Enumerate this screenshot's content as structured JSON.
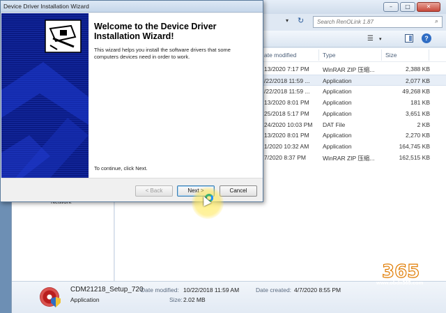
{
  "explorer": {
    "window_controls": {
      "minimize": "–",
      "maximize": "□",
      "close": "✕"
    },
    "address_dropdown": "▾",
    "refresh_icon": "↻",
    "search_placeholder": "Search RenOLink 1.87",
    "search_icon": "⌕",
    "views_icon": "☰",
    "views_dropdown": "▾",
    "help_label": "?",
    "nav_network": "Network",
    "columns": {
      "date": "ate modified",
      "type": "Type",
      "size": "Size"
    },
    "files": [
      {
        "date": "13/2020 7:17 PM",
        "type": "WinRAR ZIP 压缩...",
        "size": "2,388 KB"
      },
      {
        "date": "/22/2018 11:59 ...",
        "type": "Application",
        "size": "2,077 KB"
      },
      {
        "date": "/22/2018 11:59 ...",
        "type": "Application",
        "size": "49,268 KB"
      },
      {
        "date": "13/2020 8:01 PM",
        "type": "Application",
        "size": "181 KB"
      },
      {
        "date": "25/2018 5:17 PM",
        "type": "Application",
        "size": "3,651 KB"
      },
      {
        "date": "24/2020 10:03 PM",
        "type": "DAT File",
        "size": "2 KB"
      },
      {
        "date": "13/2020 8:01 PM",
        "type": "Application",
        "size": "2,270 KB"
      },
      {
        "date": "1/2020 10:32 AM",
        "type": "Application",
        "size": "164,745 KB"
      },
      {
        "date": "7/2020 8:37 PM",
        "type": "WinRAR ZIP 压缩...",
        "size": "162,515 KB"
      }
    ],
    "selected_index": 1,
    "details": {
      "filename": "CDM21218_Setup_720",
      "modified_label": "Date modified:",
      "modified_value": "10/22/2018 11:59 AM",
      "created_label": "Date created:",
      "created_value": "4/7/2020 8:55 PM",
      "type": "Application",
      "size_label": "Size:",
      "size_value": "2.02 MB"
    }
  },
  "wizard": {
    "title": "Device Driver Installation Wizard",
    "heading": "Welcome to the Device Driver Installation Wizard!",
    "description": "This wizard helps you install the software drivers that some computers devices need in order to work.",
    "continue_text": "To continue, click Next.",
    "buttons": {
      "back": "< Back",
      "next": "Next >",
      "cancel": "Cancel"
    }
  },
  "watermark": {
    "brand": "365",
    "url": "www.obdii365.com"
  }
}
